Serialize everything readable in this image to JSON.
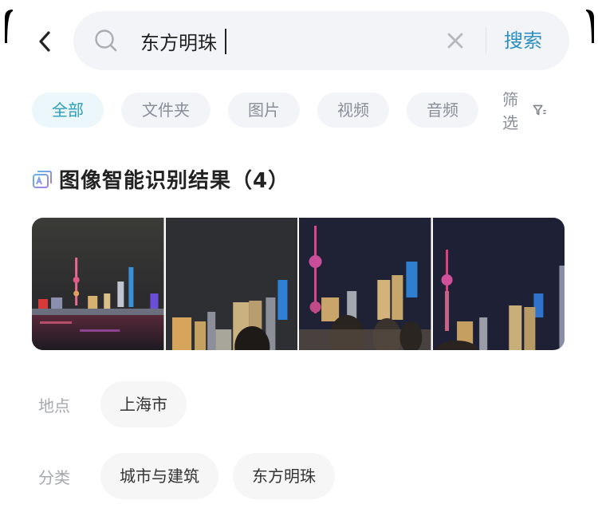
{
  "header": {
    "back_icon": "chevron-left-icon",
    "search": {
      "icon": "search-icon",
      "value": "东方明珠",
      "clear_icon": "close-icon",
      "submit_label": "搜索"
    }
  },
  "tabs": [
    {
      "label": "全部",
      "active": true
    },
    {
      "label": "文件夹",
      "active": false
    },
    {
      "label": "图片",
      "active": false
    },
    {
      "label": "视频",
      "active": false
    },
    {
      "label": "音频",
      "active": false
    }
  ],
  "filter": {
    "label": "筛选",
    "icon": "filter-icon"
  },
  "results": {
    "icon": "ai-recognition-icon",
    "title": "图像智能识别结果（4）",
    "photos": [
      {
        "alt": "东方明珠夜景 外滩江景"
      },
      {
        "alt": "陆家嘴夜景 人群"
      },
      {
        "alt": "东方明珠 人群"
      },
      {
        "alt": "东方明珠 陆家嘴夜景"
      }
    ]
  },
  "metadata": {
    "location": {
      "label": "地点",
      "tags": [
        "上海市"
      ]
    },
    "category": {
      "label": "分类",
      "tags": [
        "城市与建筑",
        "东方明珠"
      ]
    }
  },
  "colors": {
    "accent": "#2c9fb8",
    "search_button": "#2d8fbf",
    "search_bg": "#f3f4f8",
    "tab_active_bg": "#ecf7fb",
    "chip_bg": "#f6f6f7"
  }
}
